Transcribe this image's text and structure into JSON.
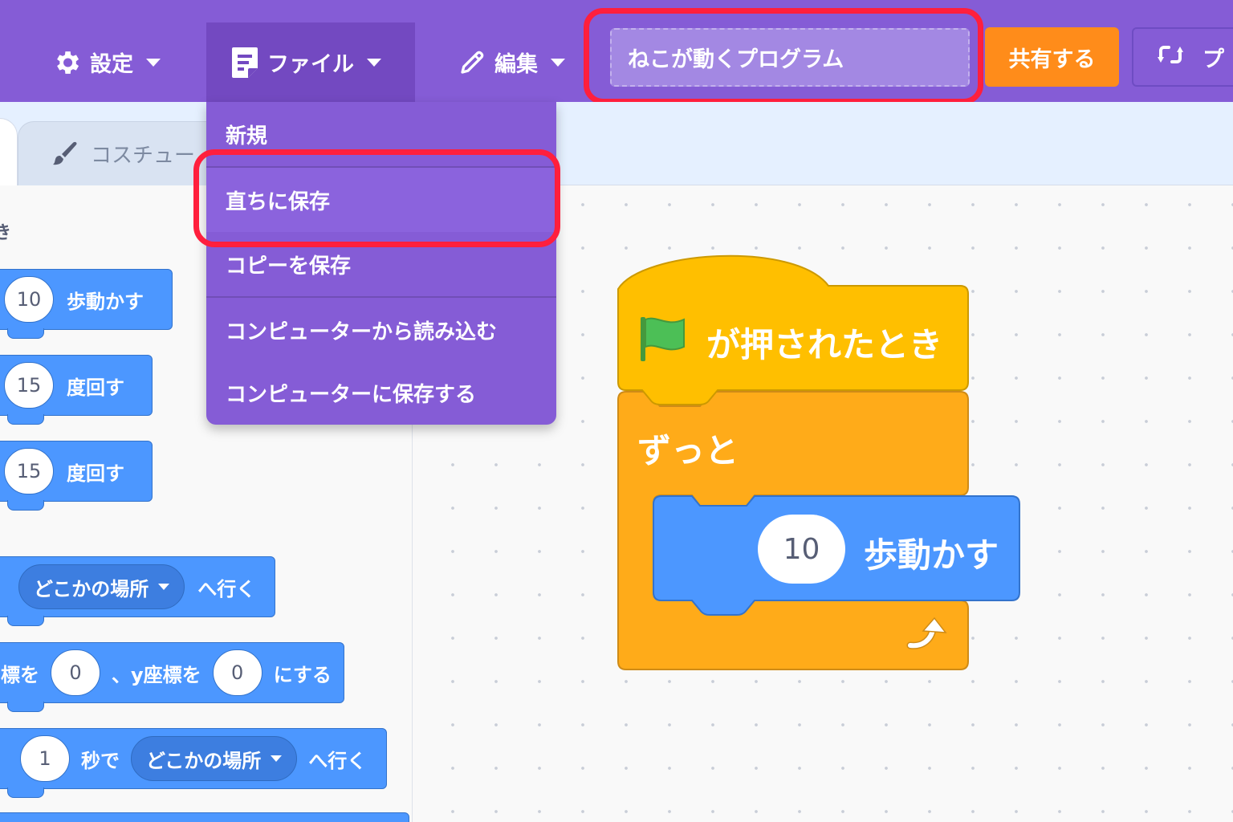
{
  "menubar": {
    "settings": "設定",
    "file": "ファイル",
    "edit": "編集",
    "project_title": "ねこが動くプログラム",
    "share": "共有する",
    "project_page": "プ"
  },
  "tabs": {
    "costume": "コスチュー"
  },
  "file_menu": {
    "items": [
      "新規",
      "直ちに保存",
      "コピーを保存",
      "コンピューターから読み込む",
      "コンピューターに保存する"
    ]
  },
  "palette": {
    "section_label": "き",
    "blocks": [
      {
        "value": "10",
        "text": "歩動かす"
      },
      {
        "value": "15",
        "text": "度回す"
      },
      {
        "value": "15",
        "text": "度回す"
      },
      {
        "dropdown": "どこかの場所",
        "text": "へ行く"
      },
      {
        "prefix": "標を",
        "x": "0",
        "mid": "、y座標を",
        "y": "0",
        "suffix": "にする"
      },
      {
        "value": "1",
        "mid": "秒で",
        "dropdown": "どこかの場所",
        "suffix": "へ行く"
      }
    ]
  },
  "script": {
    "hat": "が押されたとき",
    "forever": "ずっと",
    "move_value": "10",
    "move_text": "歩動かす"
  },
  "colors": {
    "menubar": "#855cd6",
    "share": "#ff8c1a",
    "motion": "#4c97ff",
    "events": "#ffbf00",
    "control": "#ffab19",
    "highlight": "#ff1f3d"
  },
  "icons": [
    "gear-icon",
    "file-icon",
    "pencil-icon",
    "remix-icon",
    "brush-icon",
    "green-flag-icon",
    "loop-arrow-icon"
  ]
}
